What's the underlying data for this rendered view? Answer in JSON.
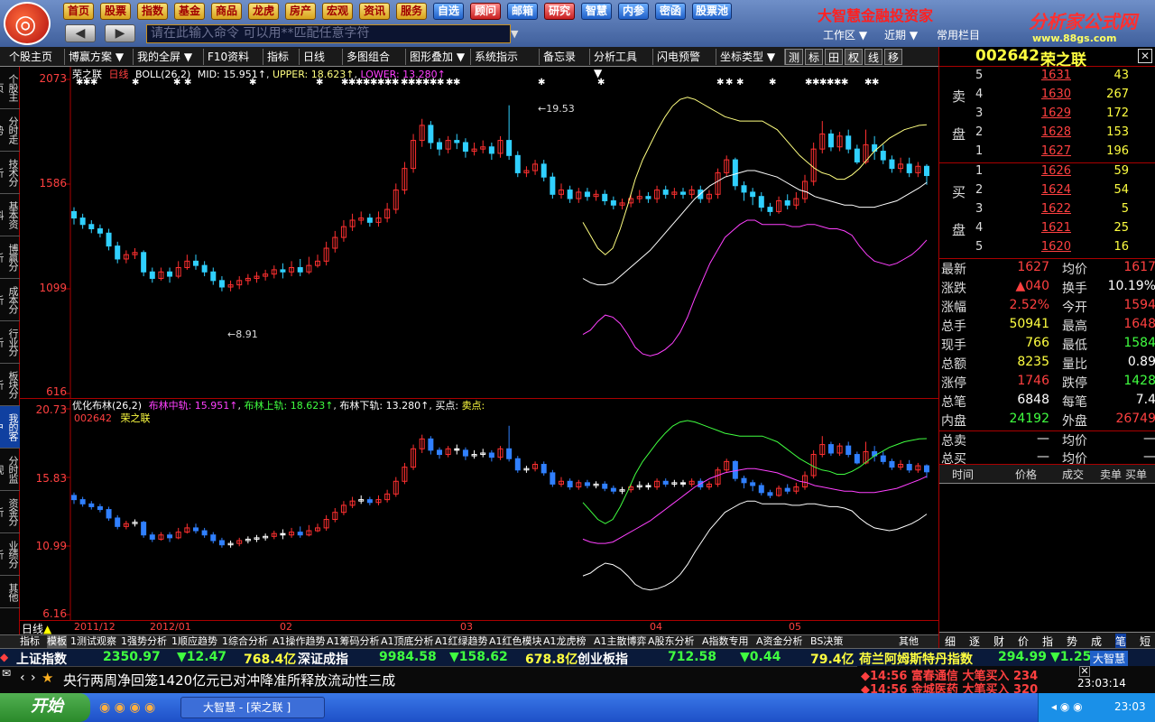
{
  "topnav": [
    "首页",
    "股票",
    "指数",
    "基金",
    "商品",
    "龙虎",
    "房产",
    "宏观",
    "资讯",
    "服务",
    "自选",
    "顾问",
    "邮箱",
    "研究",
    "智慧",
    "内参",
    "密函",
    "股票池"
  ],
  "command": {
    "placeholder": "请在此输入命令 可以用**匹配任意字符"
  },
  "brand": {
    "name": "大智慧金融投资家",
    "site": "分析家公式网",
    "url": "www.88gs.com"
  },
  "topright": {
    "workspace": "工作区",
    "recent": "近期",
    "common": "常用栏目"
  },
  "toolbar": [
    "个股主页",
    "博赢方案",
    "我的全屏",
    "F10资料",
    "指标",
    "日线",
    "多图组合",
    "图形叠加",
    "系统指示",
    "备忘录",
    "分析工具",
    "闪电预警",
    "坐标类型",
    "测",
    "标",
    "田",
    "权",
    "线",
    "移"
  ],
  "sidetabs": [
    "个股主页",
    "分时走势",
    "技术分析",
    "基本资料",
    "博赢分析",
    "成本分析",
    "行业分析",
    "板块分析",
    "我的客户",
    "分时监视",
    "资金分析",
    "业绩分析",
    "其他"
  ],
  "mainchart": {
    "title": "荣之联",
    "period": "日线",
    "indicator": "BOLL(26,2)",
    "mid_label": "MID: 15.951↑",
    "upper_label": "UPPER: 18.623↑",
    "lower_label": "LOWER: 13.280↑",
    "ylabels": [
      "2073",
      "1586",
      "1099",
      "616"
    ],
    "high_ann": "←19.53",
    "low_ann": "←8.91"
  },
  "subchart": {
    "title": "优化布林(26,2)",
    "mid": "布林中轨: 15.951↑",
    "upper": "布林上轨: 18.623↑",
    "lower": "布林下轨: 13.280↑",
    "buy": "买点:",
    "sell": "卖点:",
    "code": "002642",
    "name": "荣之联",
    "ylabels": [
      "20.73",
      "15.83",
      "10.99",
      "6.16"
    ]
  },
  "xaxis": {
    "period": "日线",
    "labels": [
      "2011/12",
      "2012/01",
      "02",
      "03",
      "04",
      "05"
    ]
  },
  "bottomtabs": [
    "指标",
    "模板",
    "1测试观察",
    "1强势分析",
    "1顺应趋势",
    "1综合分析",
    "A1操作趋势",
    "A1筹码分析",
    "A1顶底分析",
    "A1红绿趋势",
    "A1红色模块",
    "A1龙虎榜",
    "A1主散博弈",
    "A股东分析",
    "A指数专用",
    "A资金分析",
    "BS决策",
    "其他"
  ],
  "quote": {
    "code": "002642",
    "name": "荣之联",
    "sell_label": [
      "卖",
      "盘"
    ],
    "buy_label": [
      "买",
      "盘"
    ],
    "asks": [
      {
        "lv": "5",
        "price": "1631",
        "vol": "43"
      },
      {
        "lv": "4",
        "price": "1630",
        "vol": "267"
      },
      {
        "lv": "3",
        "price": "1629",
        "vol": "172"
      },
      {
        "lv": "2",
        "price": "1628",
        "vol": "153"
      },
      {
        "lv": "1",
        "price": "1627",
        "vol": "196"
      }
    ],
    "bids": [
      {
        "lv": "1",
        "price": "1626",
        "vol": "59"
      },
      {
        "lv": "2",
        "price": "1624",
        "vol": "54"
      },
      {
        "lv": "3",
        "price": "1622",
        "vol": "5"
      },
      {
        "lv": "4",
        "price": "1621",
        "vol": "25"
      },
      {
        "lv": "5",
        "price": "1620",
        "vol": "16"
      }
    ],
    "stats": [
      {
        "k1": "最新",
        "v1": "1627",
        "c1": "#ff4040",
        "k2": "均价",
        "v2": "1617",
        "c2": "#ff4040"
      },
      {
        "k1": "涨跌",
        "v1": "▲040",
        "c1": "#ff4040",
        "k2": "换手",
        "v2": "10.19%",
        "c2": "#ffffff"
      },
      {
        "k1": "涨幅",
        "v1": "2.52%",
        "c1": "#ff4040",
        "k2": "今开",
        "v2": "1594",
        "c2": "#ff4040"
      },
      {
        "k1": "总手",
        "v1": "50941",
        "c1": "#ffff40",
        "k2": "最高",
        "v2": "1648",
        "c2": "#ff4040"
      },
      {
        "k1": "现手",
        "v1": "766",
        "c1": "#ffff40",
        "k2": "最低",
        "v2": "1584",
        "c2": "#40ff40"
      },
      {
        "k1": "总额",
        "v1": "8235",
        "c1": "#ffff40",
        "k2": "量比",
        "v2": "0.89",
        "c2": "#ffffff"
      },
      {
        "k1": "涨停",
        "v1": "1746",
        "c1": "#ff4040",
        "k2": "跌停",
        "v2": "1428",
        "c2": "#40ff40"
      },
      {
        "k1": "总笔",
        "v1": "6848",
        "c1": "#ffffff",
        "k2": "每笔",
        "v2": "7.4",
        "c2": "#ffffff"
      },
      {
        "k1": "内盘",
        "v1": "24192",
        "c1": "#40ff40",
        "k2": "外盘",
        "v2": "26749",
        "c2": "#ff4040"
      },
      {
        "k1": "总卖",
        "v1": "—",
        "c1": "#ffffff",
        "k2": "均价",
        "v2": "—",
        "c2": "#ffffff"
      },
      {
        "k1": "总买",
        "v1": "—",
        "c1": "#ffffff",
        "k2": "均价",
        "v2": "—",
        "c2": "#ffffff"
      }
    ],
    "trade_header": [
      "时间",
      "价格",
      "成交",
      "卖单",
      "买单"
    ],
    "tabs": [
      "细",
      "逐",
      "财",
      "价",
      "指",
      "势",
      "成",
      "笔",
      "短"
    ]
  },
  "ticker": {
    "sh_name": "上证指数",
    "sh_val": "2350.97",
    "sh_chg": "▼12.47",
    "sh_amt": "768.4亿",
    "sz_name": "深证成指",
    "sz_val": "9984.58",
    "sz_chg": "▼158.62",
    "sz_amt": "678.8亿",
    "cy_name": "创业板指",
    "cy_val": "712.58",
    "cy_chg": "▼0.44",
    "cy_amt": "79.4亿",
    "ext_name": "荷兰阿姆斯特丹指数",
    "ext_val": "294.99",
    "ext_chg": "▼1.25"
  },
  "news": {
    "text": "央行两周净回笼1420亿元已对冲降准所释放流动性三成",
    "alerts": [
      {
        "time": "14:56",
        "name": "富春通信",
        "msg": "大笔买入 234"
      },
      {
        "time": "14:56",
        "name": "金城医药",
        "msg": "大笔买入 320"
      }
    ]
  },
  "taskbar": {
    "start": "开始",
    "task": "大智慧 - [荣之联 ]",
    "time": "23:03",
    "clock": "23:03:14",
    "logo": "大智慧"
  },
  "chart_data": [
    {
      "type": "line",
      "title": "荣之联 日线 BOLL(26,2)",
      "ylim": [
        6.16,
        20.73
      ],
      "series": [
        {
          "name": "MID",
          "values": [
            null,
            null,
            null,
            null,
            null,
            null,
            null,
            null,
            null,
            null,
            null,
            null,
            null,
            null,
            null,
            null,
            null,
            null,
            null,
            null,
            null,
            null,
            null,
            null,
            null,
            null,
            null,
            null,
            null,
            null,
            null,
            null,
            11.5,
            11.3,
            11.2,
            11.2,
            11.3,
            11.6,
            11.9,
            12.2,
            12.5,
            12.8,
            13.2,
            13.6,
            14.0,
            14.4,
            14.8,
            15.2,
            15.5,
            15.8,
            16.0,
            16.2,
            16.3,
            16.4,
            16.5,
            16.5,
            16.4,
            16.3,
            16.2,
            16.0,
            15.8,
            15.6,
            15.5,
            15.3,
            15.2,
            15.1,
            15.0,
            14.9,
            14.9,
            14.8,
            14.8,
            14.8,
            14.9,
            15.0,
            15.1,
            15.3,
            15.5,
            15.7,
            15.951
          ]
        },
        {
          "name": "UPPER",
          "values": [
            null,
            null,
            null,
            null,
            null,
            null,
            null,
            null,
            null,
            null,
            null,
            null,
            null,
            null,
            null,
            null,
            null,
            null,
            null,
            null,
            null,
            null,
            null,
            null,
            null,
            null,
            null,
            null,
            null,
            null,
            null,
            null,
            14.1,
            13.5,
            12.9,
            12.6,
            12.9,
            13.8,
            14.9,
            16.1,
            17.0,
            17.7,
            18.4,
            19.0,
            19.5,
            19.8,
            19.9,
            19.8,
            19.6,
            19.4,
            19.2,
            19.0,
            18.9,
            18.8,
            18.8,
            18.8,
            18.8,
            18.6,
            18.4,
            18.0,
            17.6,
            17.2,
            16.9,
            16.6,
            16.4,
            16.3,
            16.1,
            16.1,
            16.3,
            16.6,
            17.0,
            17.4,
            17.7,
            18.0,
            18.2,
            18.4,
            18.5,
            18.6,
            18.623
          ]
        },
        {
          "name": "LOWER",
          "values": [
            null,
            null,
            null,
            null,
            null,
            null,
            null,
            null,
            null,
            null,
            null,
            null,
            null,
            null,
            null,
            null,
            null,
            null,
            null,
            null,
            null,
            null,
            null,
            null,
            null,
            null,
            null,
            null,
            null,
            null,
            null,
            null,
            8.9,
            9.1,
            9.5,
            9.8,
            9.7,
            9.4,
            8.9,
            8.3,
            8.0,
            7.9,
            8.0,
            8.2,
            8.5,
            9.0,
            9.7,
            10.6,
            11.4,
            12.2,
            12.8,
            13.4,
            13.7,
            14.0,
            14.2,
            14.2,
            14.0,
            14.0,
            14.0,
            14.0,
            13.9,
            13.9,
            14.0,
            14.0,
            13.9,
            13.8,
            13.8,
            13.7,
            13.5,
            13.0,
            12.6,
            12.3,
            12.2,
            12.1,
            12.2,
            12.4,
            12.6,
            12.9,
            13.28
          ]
        }
      ]
    },
    {
      "type": "bar",
      "title": "K线",
      "ylim": [
        6.16,
        20.73
      ],
      "candles": [
        [
          14.6,
          14.3,
          14.8,
          14.0
        ],
        [
          14.3,
          14.0,
          14.5,
          13.8
        ],
        [
          14.0,
          13.8,
          14.2,
          13.6
        ],
        [
          13.8,
          13.6,
          14.0,
          13.4
        ],
        [
          13.6,
          13.0,
          13.8,
          12.8
        ],
        [
          13.0,
          12.4,
          13.2,
          12.2
        ],
        [
          12.4,
          12.6,
          12.8,
          12.2
        ],
        [
          12.6,
          12.7,
          12.9,
          12.4
        ],
        [
          12.7,
          11.8,
          12.8,
          11.6
        ],
        [
          11.8,
          11.5,
          12.0,
          11.3
        ],
        [
          11.5,
          11.8,
          12.0,
          11.4
        ],
        [
          11.8,
          11.6,
          12.0,
          11.3
        ],
        [
          11.6,
          12.0,
          12.3,
          11.5
        ],
        [
          12.0,
          12.3,
          12.6,
          11.9
        ],
        [
          12.3,
          12.1,
          12.6,
          11.9
        ],
        [
          12.1,
          11.8,
          12.3,
          11.6
        ],
        [
          11.8,
          11.4,
          12.0,
          11.2
        ],
        [
          11.4,
          11.1,
          11.6,
          10.9
        ],
        [
          11.1,
          11.2,
          11.4,
          10.9
        ],
        [
          11.2,
          11.4,
          11.6,
          11.0
        ],
        [
          11.4,
          11.5,
          11.7,
          11.2
        ],
        [
          11.5,
          11.6,
          11.8,
          11.3
        ],
        [
          11.6,
          11.7,
          11.9,
          11.4
        ],
        [
          11.7,
          11.9,
          12.1,
          11.5
        ],
        [
          11.9,
          11.8,
          12.2,
          11.5
        ],
        [
          11.8,
          12.0,
          12.3,
          11.6
        ],
        [
          12.0,
          11.8,
          12.4,
          11.6
        ],
        [
          11.8,
          12.1,
          12.5,
          11.7
        ],
        [
          12.1,
          12.3,
          12.6,
          12.0
        ],
        [
          12.3,
          12.9,
          13.2,
          12.1
        ],
        [
          12.9,
          13.4,
          13.7,
          12.7
        ],
        [
          13.4,
          13.9,
          14.2,
          13.2
        ],
        [
          13.9,
          14.2,
          14.5,
          13.7
        ],
        [
          14.2,
          14.3,
          14.6,
          14.0
        ],
        [
          14.3,
          14.1,
          14.5,
          13.9
        ],
        [
          14.1,
          14.3,
          14.6,
          13.9
        ],
        [
          14.3,
          14.7,
          15.0,
          14.1
        ],
        [
          14.7,
          15.6,
          15.9,
          14.5
        ],
        [
          15.6,
          16.6,
          16.9,
          15.4
        ],
        [
          16.6,
          17.9,
          18.2,
          16.4
        ],
        [
          17.9,
          18.6,
          18.9,
          17.6
        ],
        [
          18.6,
          17.8,
          18.8,
          17.5
        ],
        [
          17.8,
          17.5,
          18.0,
          17.2
        ],
        [
          17.5,
          17.9,
          18.1,
          17.3
        ],
        [
          17.9,
          17.8,
          18.2,
          17.5
        ],
        [
          17.8,
          17.4,
          18.0,
          17.1
        ],
        [
          17.4,
          17.5,
          17.8,
          17.2
        ],
        [
          17.5,
          17.6,
          17.9,
          17.3
        ],
        [
          17.6,
          17.3,
          17.8,
          17.0
        ],
        [
          17.3,
          17.9,
          18.1,
          17.1
        ],
        [
          17.9,
          17.2,
          19.53,
          17.0
        ],
        [
          17.2,
          16.4,
          17.4,
          16.2
        ],
        [
          16.4,
          16.5,
          16.7,
          16.2
        ],
        [
          16.5,
          16.8,
          17.0,
          16.3
        ],
        [
          16.8,
          16.2,
          17.0,
          16.0
        ],
        [
          16.2,
          15.4,
          16.4,
          15.2
        ],
        [
          15.4,
          15.6,
          15.9,
          15.2
        ],
        [
          15.6,
          15.2,
          15.8,
          15.0
        ],
        [
          15.2,
          15.5,
          15.7,
          15.0
        ],
        [
          15.5,
          15.3,
          15.7,
          15.1
        ],
        [
          15.3,
          15.4,
          15.6,
          15.1
        ],
        [
          15.4,
          15.1,
          15.6,
          14.9
        ],
        [
          15.1,
          14.9,
          15.3,
          14.7
        ],
        [
          14.9,
          15.0,
          15.2,
          14.7
        ],
        [
          15.0,
          15.2,
          15.4,
          14.8
        ],
        [
          15.2,
          15.3,
          15.6,
          15.0
        ],
        [
          15.3,
          15.2,
          15.5,
          15.0
        ],
        [
          15.2,
          15.6,
          15.8,
          15.0
        ],
        [
          15.6,
          15.4,
          15.8,
          15.2
        ],
        [
          15.4,
          15.5,
          15.7,
          15.2
        ],
        [
          15.5,
          15.4,
          15.7,
          15.2
        ],
        [
          15.4,
          15.6,
          15.8,
          15.2
        ],
        [
          15.6,
          15.2,
          15.8,
          15.0
        ],
        [
          15.2,
          15.4,
          15.6,
          15.0
        ],
        [
          15.4,
          16.4,
          16.6,
          15.2
        ],
        [
          16.4,
          17.0,
          17.2,
          16.2
        ],
        [
          17.0,
          15.8,
          17.1,
          15.6
        ],
        [
          15.8,
          15.5,
          16.0,
          15.1
        ],
        [
          15.5,
          15.3,
          15.7,
          14.9
        ],
        [
          15.3,
          14.8,
          15.5,
          14.6
        ],
        [
          14.8,
          14.6,
          15.0,
          14.4
        ],
        [
          14.6,
          15.1,
          15.3,
          14.5
        ],
        [
          15.1,
          14.9,
          15.4,
          14.7
        ],
        [
          14.9,
          15.2,
          15.5,
          14.7
        ],
        [
          15.2,
          16.0,
          16.3,
          15.0
        ],
        [
          16.0,
          17.5,
          17.8,
          15.8
        ],
        [
          17.5,
          18.2,
          18.8,
          17.3
        ],
        [
          18.2,
          17.6,
          18.4,
          17.4
        ],
        [
          17.6,
          18.1,
          18.3,
          17.4
        ],
        [
          18.1,
          17.5,
          18.4,
          17.3
        ],
        [
          17.5,
          16.9,
          17.7,
          16.8
        ],
        [
          16.9,
          17.7,
          18.4,
          16.8
        ],
        [
          17.7,
          17.4,
          18.1,
          17.0
        ],
        [
          17.4,
          17.0,
          17.7,
          16.8
        ],
        [
          17.0,
          16.6,
          17.2,
          16.4
        ],
        [
          16.6,
          16.8,
          17.1,
          16.4
        ],
        [
          16.8,
          16.4,
          17.1,
          16.2
        ],
        [
          16.4,
          16.7,
          16.9,
          16.2
        ],
        [
          16.7,
          16.27,
          16.8,
          15.84
        ]
      ]
    }
  ]
}
